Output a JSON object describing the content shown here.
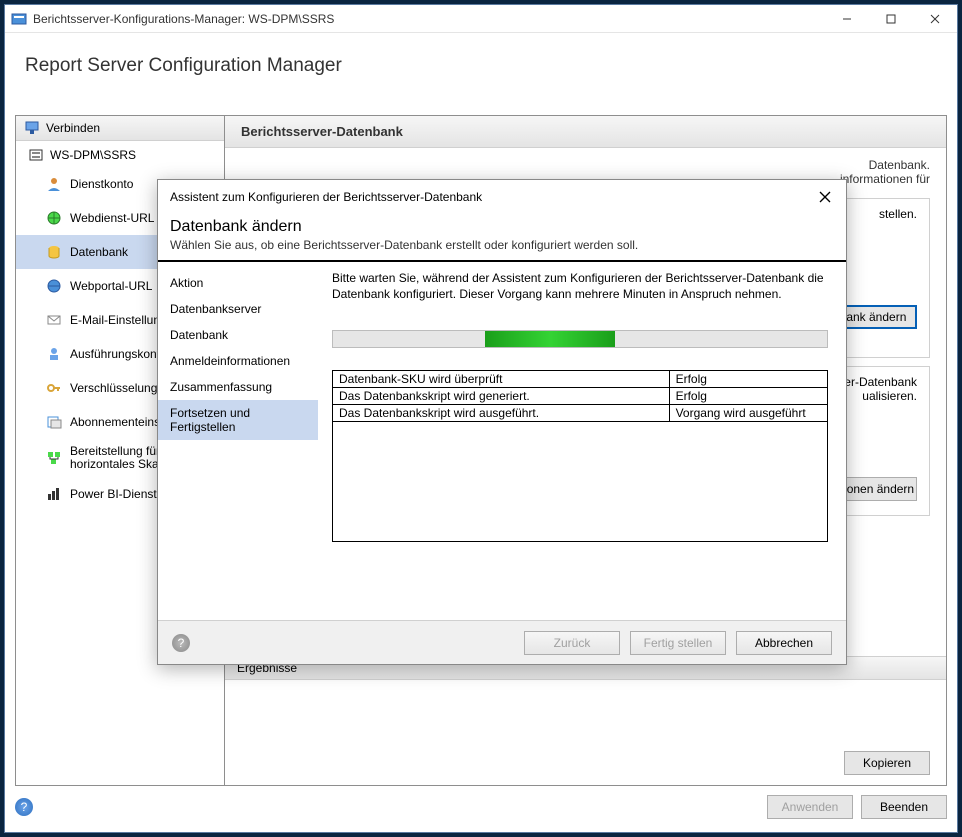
{
  "window": {
    "title": "Berichtsserver-Konfigurations-Manager: WS-DPM\\SSRS"
  },
  "app": {
    "title": "Report Server Configuration Manager"
  },
  "sidebar": {
    "connect_label": "Verbinden",
    "server_label": "WS-DPM\\SSRS",
    "items": [
      {
        "label": "Dienstkonto"
      },
      {
        "label": "Webdienst-URL"
      },
      {
        "label": "Datenbank"
      },
      {
        "label": "Webportal-URL"
      },
      {
        "label": "E-Mail-Einstellungen"
      },
      {
        "label": "Ausführungskonto"
      },
      {
        "label": "Verschlüsselungsschlüssel"
      },
      {
        "label": "Abonnementeinstellungen"
      },
      {
        "label": "Bereitstellung für horizontales Skalieren"
      },
      {
        "label": "Power BI-Dienst (Cloud)"
      }
    ]
  },
  "main": {
    "header": "Berichtsserver-Datenbank",
    "behind_line1": "Datenbank.",
    "behind_line2": "informationen für",
    "gb1_line": "stellen.",
    "btn_db_change": "Datenbank ändern",
    "gb2_line1": "chtsserver-Datenbank",
    "gb2_line2": "ualisieren.",
    "btn_cred_change": "einformationen ändern",
    "results_header": "Ergebnisse",
    "btn_copy": "Kopieren"
  },
  "footer": {
    "apply": "Anwenden",
    "exit": "Beenden"
  },
  "modal": {
    "title": "Assistent zum Konfigurieren der Berichtsserver-Datenbank",
    "h2": "Datenbank ändern",
    "sub": "Wählen Sie aus, ob eine Berichtsserver-Datenbank erstellt oder konfiguriert werden soll.",
    "steps": [
      "Aktion",
      "Datenbankserver",
      "Datenbank",
      "Anmeldeinformationen",
      "Zusammenfassung",
      "Fortsetzen und Fertigstellen"
    ],
    "body_msg": "Bitte warten Sie, während der Assistent zum Konfigurieren der Berichtsserver-Datenbank die Datenbank konfiguriert. Dieser Vorgang kann mehrere Minuten in Anspruch nehmen.",
    "status_rows": [
      {
        "task": "Datenbank-SKU wird überprüft",
        "state": "Erfolg"
      },
      {
        "task": "Das Datenbankskript wird generiert.",
        "state": "Erfolg"
      },
      {
        "task": "Das Datenbankskript wird ausgeführt.",
        "state": "Vorgang wird ausgeführt"
      }
    ],
    "btn_back": "Zurück",
    "btn_finish": "Fertig stellen",
    "btn_cancel": "Abbrechen"
  }
}
